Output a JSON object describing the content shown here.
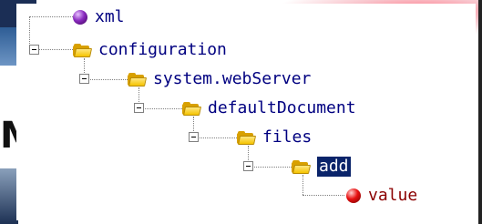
{
  "tree": {
    "nodes": [
      {
        "label": "xml",
        "icon": "xml-declaration-icon"
      },
      {
        "label": "configuration",
        "icon": "folder-icon"
      },
      {
        "label": "system.webServer",
        "icon": "folder-icon"
      },
      {
        "label": "defaultDocument",
        "icon": "folder-icon"
      },
      {
        "label": "files",
        "icon": "folder-icon"
      },
      {
        "label": "add",
        "icon": "folder-icon",
        "selected": true
      },
      {
        "label": "value",
        "icon": "attribute-icon"
      }
    ]
  },
  "colors": {
    "element_text": "#000080",
    "attribute_text": "#8b0000",
    "selection_bg": "#0a246a",
    "folder": "#f5c400"
  }
}
